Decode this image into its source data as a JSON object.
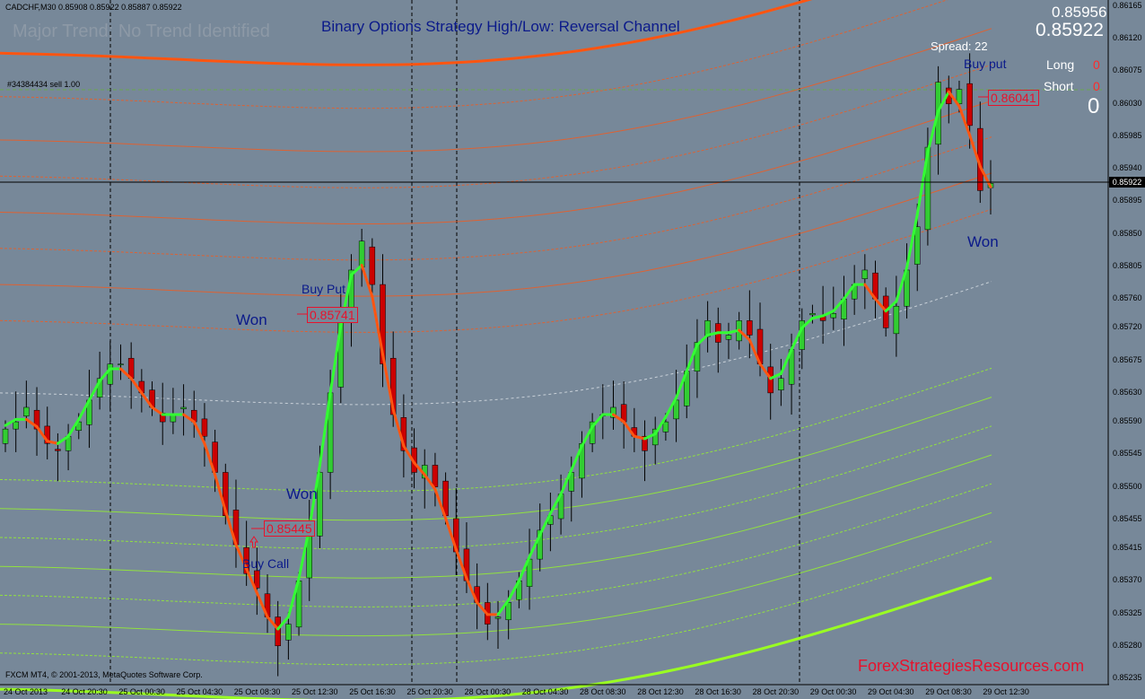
{
  "header": {
    "symbol_info": "CADCHF,M30  0.85908 0.85922 0.85887 0.85922",
    "major_trend": "Major Trend: No Trend Identified",
    "title": "Binary Options Strategy  High/Low: Reversal Channel",
    "order_line_label": "#34384434 sell 1.00"
  },
  "panel": {
    "bid_top": "0.85956",
    "bid_big": "0.85922",
    "spread": "Spread: 22",
    "long_label": "Long",
    "long_value": "0",
    "short_label": "Short",
    "short_value": "0",
    "total_value": "0"
  },
  "annotations": {
    "buy_put_1": "Buy Put",
    "won_1": "Won",
    "price_1": "0.85741",
    "won_2": "Won",
    "price_2": "0.85445",
    "buy_call": "Buy Call",
    "buy_put_2": "Buy put",
    "price_3": "0.86041",
    "won_3": "Won"
  },
  "footer": {
    "copyright": "FXCM MT4, © 2001-2013, MetaQuotes Software Corp.",
    "watermark": "ForexStrategiesResources.com"
  },
  "colors": {
    "background": "#778899",
    "bull_candle": "#32cd32",
    "bear_candle": "#cc0000",
    "trend_up": "#33ff33",
    "trend_down": "#ff5511",
    "upper_band": "#ff5511",
    "lower_band": "#9aff22",
    "title": "#0b1a8a",
    "watermark": "#e8122c"
  },
  "chart_data": {
    "type": "candlestick",
    "symbol": "CADCHF",
    "timeframe": "M30",
    "current_price": 0.85922,
    "y_ticks": [
      "0.86165",
      "0.86120",
      "0.86075",
      "0.86030",
      "0.85985",
      "0.85940",
      "0.85895",
      "0.85850",
      "0.85805",
      "0.85760",
      "0.85720",
      "0.85675",
      "0.85630",
      "0.85590",
      "0.85545",
      "0.85500",
      "0.85455",
      "0.85415",
      "0.85370",
      "0.85325",
      "0.85280",
      "0.85235"
    ],
    "ylim": [
      0.85235,
      0.86165
    ],
    "x_ticks": [
      "24 Oct 2013",
      "24 Oct 20:30",
      "25 Oct 00:30",
      "25 Oct 04:30",
      "25 Oct 08:30",
      "25 Oct 12:30",
      "25 Oct 16:30",
      "25 Oct 20:30",
      "28 Oct 00:30",
      "28 Oct 04:30",
      "28 Oct 08:30",
      "28 Oct 12:30",
      "28 Oct 16:30",
      "28 Oct 20:30",
      "29 Oct 00:30",
      "29 Oct 04:30",
      "29 Oct 08:30",
      "29 Oct 12:30"
    ],
    "close_series": [
      0.8558,
      0.8559,
      0.8561,
      0.8558,
      0.8556,
      0.8555,
      0.8557,
      0.8559,
      0.8562,
      0.8565,
      0.8567,
      0.8567,
      0.8565,
      0.8563,
      0.8561,
      0.8559,
      0.856,
      0.8561,
      0.8559,
      0.8557,
      0.8552,
      0.8546,
      0.8542,
      0.8538,
      0.8536,
      0.8532,
      0.8528,
      0.8531,
      0.8537,
      0.8544,
      0.8552,
      0.8563,
      0.8574,
      0.858,
      0.8584,
      0.8578,
      0.8567,
      0.856,
      0.8555,
      0.8552,
      0.8553,
      0.855,
      0.8546,
      0.8541,
      0.8537,
      0.8534,
      0.8531,
      0.8532,
      0.8534,
      0.8537,
      0.854,
      0.8544,
      0.8546,
      0.8549,
      0.8552,
      0.8556,
      0.8559,
      0.856,
      0.8561,
      0.8559,
      0.8557,
      0.8555,
      0.8558,
      0.8559,
      0.8562,
      0.8566,
      0.857,
      0.8573,
      0.857,
      0.8571,
      0.8573,
      0.8571,
      0.8567,
      0.8563,
      0.8565,
      0.8569,
      0.8573,
      0.8574,
      0.8573,
      0.8574,
      0.8576,
      0.8578,
      0.858,
      0.8576,
      0.8572,
      0.8575,
      0.858,
      0.8586,
      0.8597,
      0.8606,
      0.8603,
      0.8605,
      0.86,
      0.8591,
      0.8592
    ]
  }
}
